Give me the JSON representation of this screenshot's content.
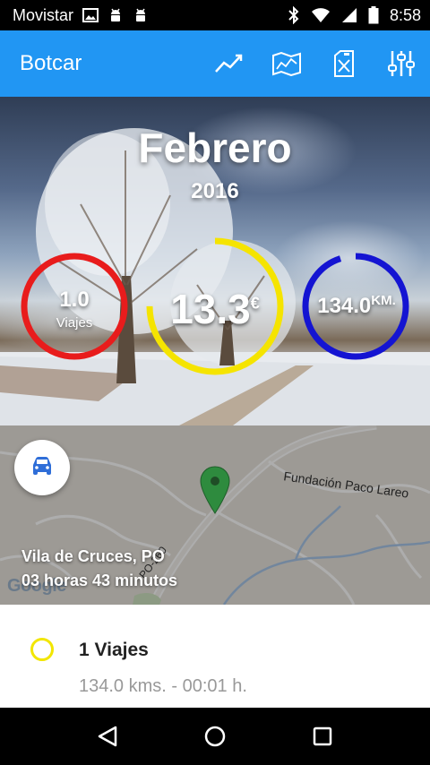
{
  "status_bar": {
    "carrier": "Movistar",
    "time": "8:58",
    "icons": [
      "image-icon",
      "android-icon",
      "android-icon",
      "bluetooth-icon",
      "wifi-icon",
      "signal-icon",
      "battery-icon"
    ]
  },
  "app_bar": {
    "title": "Botcar",
    "actions": [
      "chart-line-icon",
      "map-icon",
      "fuel-can-icon",
      "settings-sliders-icon"
    ]
  },
  "summary": {
    "month": "Febrero",
    "year": "2016",
    "trips": {
      "value": "1.0",
      "label": "Viajes",
      "color": "#e81c1c",
      "progress": 1.0
    },
    "cost": {
      "value": "13.3",
      "unit": "€",
      "color": "#f5e400",
      "progress": 0.75
    },
    "distance": {
      "value": "134.0",
      "unit": "KM.",
      "color": "#1414d2",
      "progress": 0.95
    }
  },
  "map": {
    "place_label": "Fundación Paco Lareo",
    "road_label": "PO-260",
    "brand": "Google",
    "location": "Vila de Cruces, PO",
    "duration": "03 horas 43 minutos",
    "fab_icon": "car-icon",
    "marker_color": "#2e8b3e"
  },
  "trip_list": [
    {
      "title": "1 Viajes",
      "subtitle": "134.0 kms. - 00:01 h.",
      "dot_color": "#f2e600"
    }
  ],
  "nav_bar": {
    "buttons": [
      "back-icon",
      "home-icon",
      "recents-icon"
    ]
  },
  "colors": {
    "app_bar": "#2196f3"
  }
}
